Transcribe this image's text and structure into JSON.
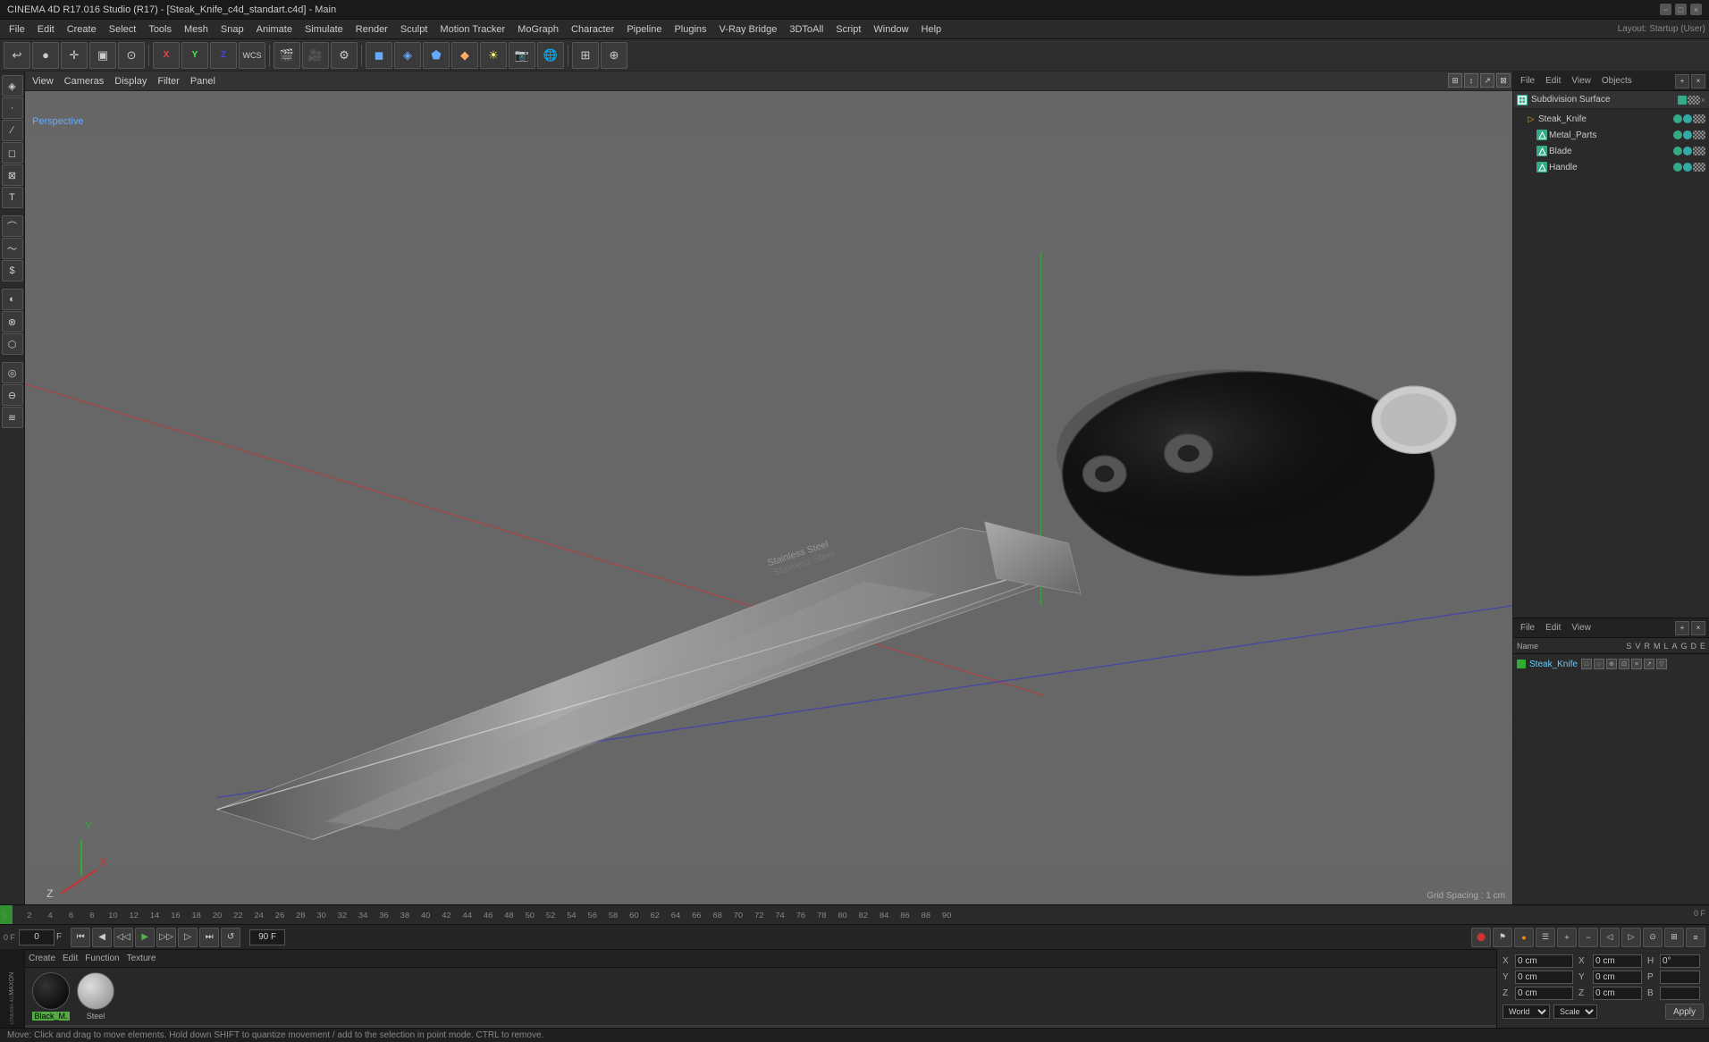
{
  "titleBar": {
    "title": "CINEMA 4D R17.016 Studio (R17) - [Steak_Knife_c4d_standart.c4d] - Main",
    "controls": [
      "−",
      "□",
      "×"
    ]
  },
  "menuBar": {
    "items": [
      "File",
      "Edit",
      "Create",
      "Select",
      "Tools",
      "Mesh",
      "Snap",
      "Animate",
      "Simulate",
      "Render",
      "Sculpt",
      "Motion Tracker",
      "MoGraph",
      "Character",
      "Pipeline",
      "Plugins",
      "V-Ray Bridge",
      "3DToAll",
      "Script",
      "Window",
      "Help"
    ],
    "layoutLabel": "Layout:",
    "layoutValue": "Startup (User)"
  },
  "viewport": {
    "menus": [
      "View",
      "Cameras",
      "Display",
      "Filter",
      "Panel"
    ],
    "perspectiveLabel": "Perspective",
    "gridSpacing": "Grid Spacing : 1 cm"
  },
  "objectManager": {
    "tabs": [
      "File",
      "Edit",
      "View",
      "Objects"
    ],
    "topItem": "Subdivision Surface",
    "items": [
      {
        "name": "Steak_Knife",
        "indent": 0,
        "color": "#39a",
        "type": "null"
      },
      {
        "name": "Metal_Parts",
        "indent": 1,
        "color": "#39a",
        "type": "mesh"
      },
      {
        "name": "Blade",
        "indent": 1,
        "color": "#39a",
        "type": "mesh"
      },
      {
        "name": "Handle",
        "indent": 1,
        "color": "#39a",
        "type": "mesh"
      }
    ]
  },
  "attributeManager": {
    "tabs": [
      "File",
      "Edit",
      "View"
    ],
    "columns": [
      "Name",
      "S",
      "V",
      "R",
      "M",
      "L",
      "A",
      "G",
      "D",
      "E"
    ],
    "row": {
      "name": "Steak_Knife",
      "color": "#3a3"
    }
  },
  "timeline": {
    "frames": [
      0,
      2,
      4,
      6,
      8,
      10,
      12,
      14,
      16,
      18,
      20,
      22,
      24,
      26,
      28,
      30,
      32,
      34,
      36,
      38,
      40,
      42,
      44,
      46,
      48,
      50,
      52,
      54,
      56,
      58,
      60,
      62,
      64,
      66,
      68,
      70,
      72,
      74,
      76,
      78,
      80,
      82,
      84,
      86,
      88,
      90
    ],
    "currentFrame": "0 F",
    "startFrame": "0 F",
    "endFrame": "90 F",
    "maxFrame": "90 F"
  },
  "transport": {
    "currentFrame": "0 F",
    "minFrame": "0",
    "maxFrame": "90 F",
    "buttons": [
      "⏮",
      "◀◀",
      "◀",
      "▶",
      "▶▶",
      "⏭",
      "↺"
    ]
  },
  "materials": {
    "menuItems": [
      "Create",
      "Edit",
      "Function",
      "Texture"
    ],
    "swatches": [
      {
        "name": "Black_M.",
        "type": "black"
      },
      {
        "name": "Steel",
        "type": "steel"
      }
    ]
  },
  "coordinates": {
    "x": {
      "pos": "0 cm",
      "size": "0 cm",
      "dim": "0°"
    },
    "y": {
      "pos": "0 cm",
      "size": "0 cm",
      "dim": ""
    },
    "z": {
      "pos": "0 cm",
      "size": "0 cm",
      "dim": ""
    },
    "mode1": "World",
    "mode2": "Scale",
    "applyLabel": "Apply"
  },
  "statusBar": {
    "text": "Move: Click and drag to move elements. Hold down SHIFT to quantize movement / add to the selection in point mode. CTRL to remove."
  }
}
